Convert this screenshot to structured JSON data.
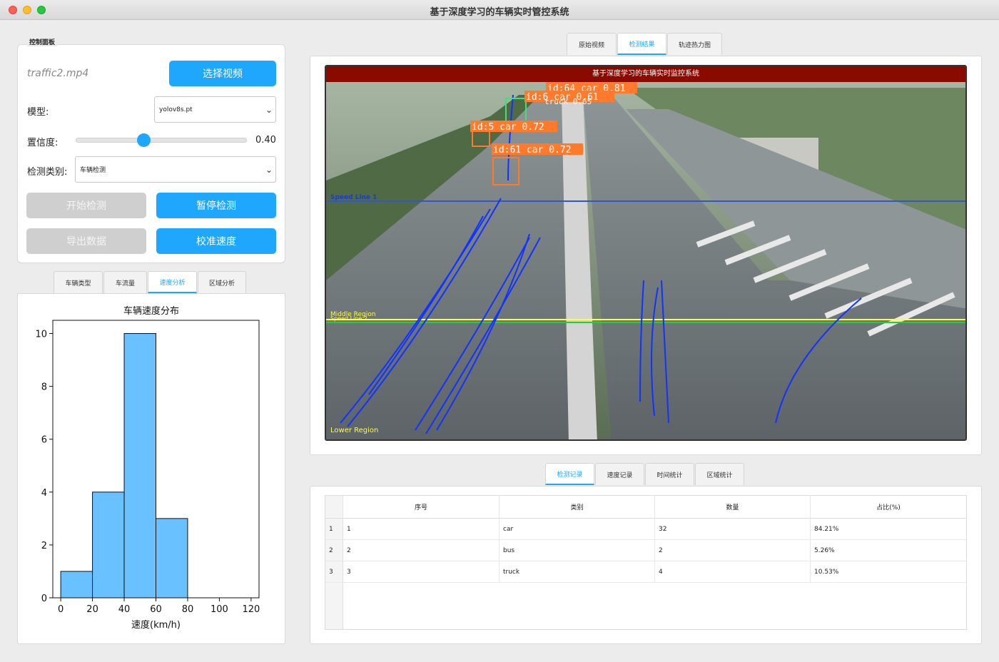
{
  "window": {
    "title": "基于深度学习的车辆实时管控系统"
  },
  "control_panel": {
    "title": "控制面板",
    "file_name": "traffic2.mp4",
    "select_video_label": "选择视频",
    "model_label": "模型:",
    "model_value": "yolov8s.pt",
    "confidence_label": "置信度:",
    "confidence_value": "0.40",
    "confidence_fraction": 0.4,
    "category_label": "检测类别:",
    "category_value": "车辆检测",
    "start_label": "开始检测",
    "pause_label": "暂停检测",
    "export_label": "导出数据",
    "calibrate_label": "校准速度"
  },
  "analysis_tabs": [
    {
      "label": "车辆类型",
      "active": false
    },
    {
      "label": "车流量",
      "active": false
    },
    {
      "label": "速度分析",
      "active": true
    },
    {
      "label": "区域分析",
      "active": false
    }
  ],
  "chart_data": {
    "type": "bar",
    "title": "车辆速度分布",
    "xlabel": "速度(km/h)",
    "ylabel": "",
    "bin_edges": [
      0,
      20,
      40,
      60,
      80
    ],
    "values": [
      1,
      4,
      10,
      3
    ],
    "xlim": [
      -5,
      125
    ],
    "ylim": [
      0,
      10.5
    ],
    "xticks": [
      0,
      20,
      40,
      60,
      80,
      100,
      120
    ],
    "yticks": [
      0,
      2,
      4,
      6,
      8,
      10
    ],
    "bar_color": "#6ac1ff",
    "grid": false
  },
  "video_tabs": [
    {
      "label": "原始视频",
      "active": false
    },
    {
      "label": "检测结果",
      "active": true
    },
    {
      "label": "轨迹热力图",
      "active": false
    }
  ],
  "video": {
    "header": "基于深度学习的车辆实时监控系统",
    "line_labels": {
      "upper": "Speed Line 1",
      "middle": "Middle Region",
      "speed2": "Speed Line 2",
      "lower": "Lower Region"
    },
    "detections": [
      {
        "label": "id:64 car 0.81"
      },
      {
        "label": "id:6 car 0.61"
      },
      {
        "label": "truck 0.65"
      },
      {
        "label": "id:5 car 0.72"
      },
      {
        "label": "id:61 car 0.72"
      }
    ],
    "colors": {
      "upper_line": "#3355cc",
      "middle_line": "#ffff33",
      "speed2_line": "#22cc44",
      "track": "#1133ff",
      "box": "#ff7a2a",
      "box_green": "#3ee07a"
    }
  },
  "record_tabs": [
    {
      "label": "检测记录",
      "active": true
    },
    {
      "label": "速度记录",
      "active": false
    },
    {
      "label": "时间统计",
      "active": false
    },
    {
      "label": "区域统计",
      "active": false
    }
  ],
  "table": {
    "headers": [
      "序号",
      "类别",
      "数量",
      "占比(%)"
    ],
    "rows": [
      {
        "rownum": "1",
        "cells": [
          "1",
          "car",
          "32",
          "84.21%"
        ]
      },
      {
        "rownum": "2",
        "cells": [
          "2",
          "bus",
          "2",
          "5.26%"
        ]
      },
      {
        "rownum": "3",
        "cells": [
          "3",
          "truck",
          "4",
          "10.53%"
        ]
      }
    ]
  }
}
